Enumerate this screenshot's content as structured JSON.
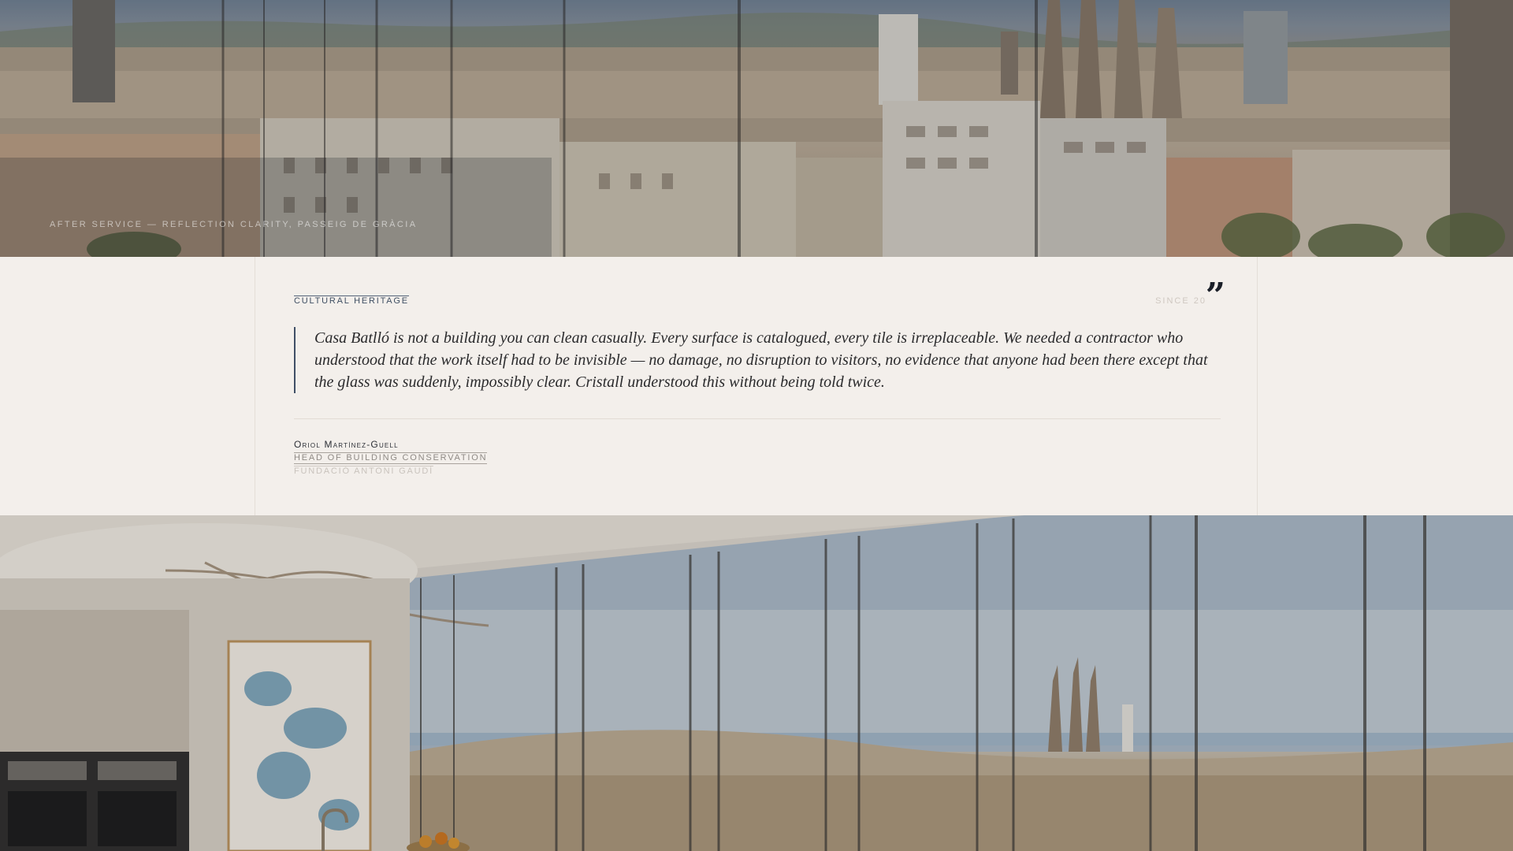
{
  "hero_top": {
    "caption": "After service — reflection clarity, Passeig de Gràcia",
    "image": "barcelona-skyline-through-glass"
  },
  "testimonial": {
    "category": "Cultural Heritage",
    "since": "Since 20",
    "quote_mark": "”",
    "quote": "Casa Batlló is not a building you can clean casually. Every surface is catalogued, every tile is irreplaceable. We needed a contractor who understood that the work itself had to be invisible — no damage, no disruption to visitors, no evidence that anyone had been there except that the glass was suddenly, impossibly clear. Cristall understood this without being told twice.",
    "author": {
      "name": "Oriol Martínez-Guell",
      "role": "Head of Building Conservation",
      "organization": "Fundació Antoni Gaudí"
    }
  },
  "hero_bottom": {
    "image": "penthouse-kitchen-panoramic-glass-view"
  },
  "colors": {
    "background": "#f3efeb",
    "accent": "#3f4f66",
    "text": "#2a2a2c"
  }
}
